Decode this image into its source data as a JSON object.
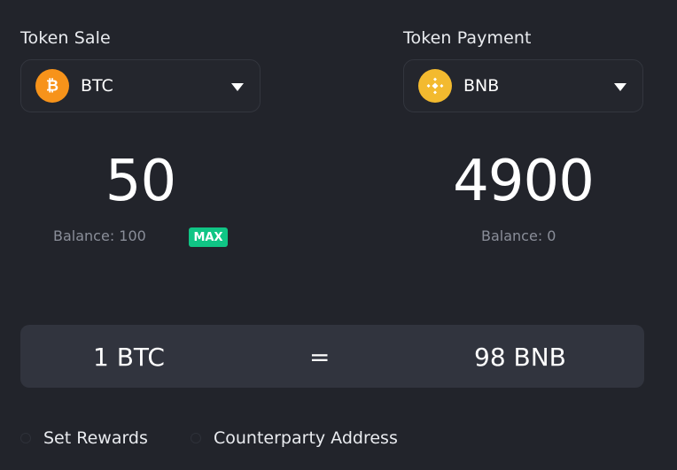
{
  "sale": {
    "label": "Token Sale",
    "token": "BTC",
    "token_icon": "bitcoin-icon",
    "amount": "50",
    "balance": "Balance: 100",
    "max_label": "MAX"
  },
  "payment": {
    "label": "Token Payment",
    "token": "BNB",
    "token_icon": "binance-icon",
    "amount": "4900",
    "balance": "Balance: 0"
  },
  "rate": {
    "left": "1 BTC",
    "equals": "=",
    "right": "98 BNB"
  },
  "options": [
    {
      "label": "Set Rewards"
    },
    {
      "label": "Counterparty Address"
    }
  ],
  "colors": {
    "background": "#22242b",
    "panel": "#31343e",
    "accent_green": "#10c585",
    "btc_orange": "#f7931a",
    "bnb_yellow": "#f3ba2f",
    "muted_text": "#8a8e99"
  }
}
